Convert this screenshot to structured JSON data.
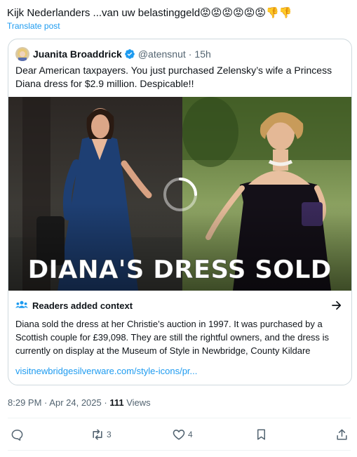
{
  "post": {
    "text": "Kijk Nederlanders ...van uw belastinggeld",
    "emojis": [
      "😡",
      "😡",
      "😡",
      "😡",
      "😡",
      "😡",
      "👎",
      "👎"
    ],
    "translate_label": "Translate post"
  },
  "quote": {
    "author_name": "Juanita Broaddrick",
    "handle": "@atensnut",
    "separator": "·",
    "time": "15h",
    "text": "Dear American taxpayers.  You just purchased Zelensky’s wife a Princess Diana dress for $2.9 million.   Despicable!!",
    "image_overlay_text": "DIANA'S DRESS SOLD"
  },
  "context": {
    "title": "Readers added context",
    "text": "Diana sold the dress at her Christie’s auction in 1997.  It was purchased by a Scottish couple for £39,098.  They are still the rightful owners, and the dress is currently on display at the Museum of Style in Newbridge, County Kildare",
    "link": "visitnewbridgesilverware.com/style-icons/pr..."
  },
  "meta": {
    "time": "8:29 PM",
    "separator": "·",
    "date": "Apr 24, 2025",
    "views_count": "111",
    "views_label": "Views"
  },
  "actions": {
    "reply_count": "",
    "repost_count": "3",
    "like_count": "4"
  },
  "colors": {
    "link": "#1d9bf0",
    "verified": "#1d9bf0",
    "secondary_text": "#536471",
    "border": "#cfd9de"
  },
  "icons": [
    "verified-badge-icon",
    "readers-context-icon",
    "arrow-right-icon",
    "reply-icon",
    "repost-icon",
    "like-icon",
    "bookmark-icon",
    "share-icon",
    "loading-spinner-icon"
  ]
}
